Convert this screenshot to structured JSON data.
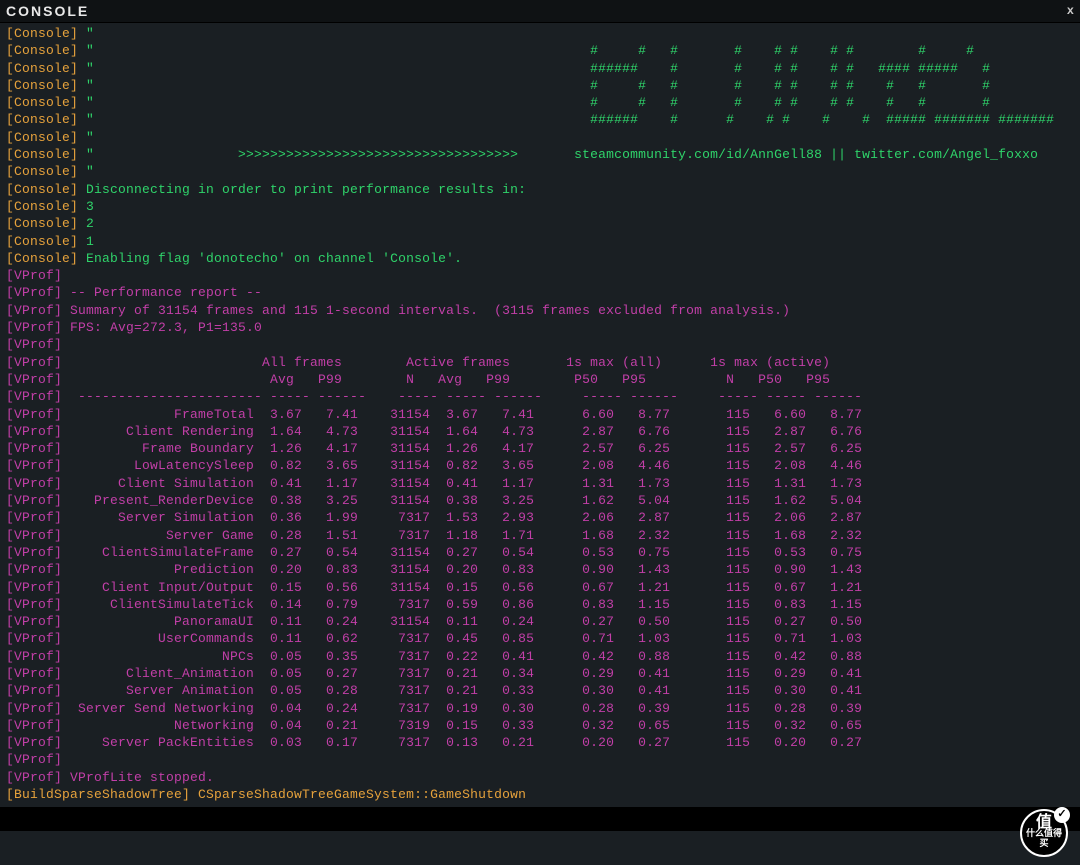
{
  "window": {
    "title": "CONSOLE",
    "close_label": "x"
  },
  "ascii": [
    "[Console] \"                                                              #     #   #       #    # #    # #        #     #",
    "[Console] \"                                                              ######    #       #    # #    # #   #### #####   #",
    "[Console] \"                                                              #     #   #       #    # #    # #    #   #       #",
    "[Console] \"                                                              #     #   #       #    # #    # #    #   #       #",
    "[Console] \"                                                              ######    #      #    # #    #    #  ##### ####### #######",
    "[Console] \"",
    "[Console] \"                  >>>>>>>>>>>>>>>>>>>>>>>>>>>>>>>>>>>       steamcommunity.com/id/AnnGell88 || twitter.com/Angel_foxxo      <<<<<<<<<<<<<<<<<<",
    "[Console] \""
  ],
  "disconnect_msg": "Disconnecting in order to print performance results in:",
  "countdown": [
    "3",
    "2",
    "1"
  ],
  "enable_flag_msg": "Enabling flag 'donotecho' on channel 'Console'.",
  "vprof_header": [
    "",
    "-- Performance report --",
    "Summary of 31154 frames and 115 1-second intervals.  (3115 frames excluded from analysis.)",
    "FPS: Avg=272.3, P1=135.0",
    ""
  ],
  "table_head1": "                        All frames        Active frames       1s max (all)      1s max (active)",
  "table_head2": "                         Avg   P99        N   Avg   P99        P50   P95          N   P50   P95",
  "table_dash": " ----------------------- ----- ------    ----- ----- ------     ----- ------     ----- ----- ------",
  "rows": [
    {
      "name": "FrameTotal",
      "avg": "3.67",
      "p99": "7.41",
      "an": "31154",
      "aavg": "3.67",
      "ap99": "7.41",
      "p50": "6.60",
      "p95": "8.77",
      "sn": "115",
      "sp50": "6.60",
      "sp95": "8.77"
    },
    {
      "name": "Client Rendering",
      "avg": "1.64",
      "p99": "4.73",
      "an": "31154",
      "aavg": "1.64",
      "ap99": "4.73",
      "p50": "2.87",
      "p95": "6.76",
      "sn": "115",
      "sp50": "2.87",
      "sp95": "6.76"
    },
    {
      "name": "Frame Boundary",
      "avg": "1.26",
      "p99": "4.17",
      "an": "31154",
      "aavg": "1.26",
      "ap99": "4.17",
      "p50": "2.57",
      "p95": "6.25",
      "sn": "115",
      "sp50": "2.57",
      "sp95": "6.25"
    },
    {
      "name": "LowLatencySleep",
      "avg": "0.82",
      "p99": "3.65",
      "an": "31154",
      "aavg": "0.82",
      "ap99": "3.65",
      "p50": "2.08",
      "p95": "4.46",
      "sn": "115",
      "sp50": "2.08",
      "sp95": "4.46"
    },
    {
      "name": "Client Simulation",
      "avg": "0.41",
      "p99": "1.17",
      "an": "31154",
      "aavg": "0.41",
      "ap99": "1.17",
      "p50": "1.31",
      "p95": "1.73",
      "sn": "115",
      "sp50": "1.31",
      "sp95": "1.73"
    },
    {
      "name": "Present_RenderDevice",
      "avg": "0.38",
      "p99": "3.25",
      "an": "31154",
      "aavg": "0.38",
      "ap99": "3.25",
      "p50": "1.62",
      "p95": "5.04",
      "sn": "115",
      "sp50": "1.62",
      "sp95": "5.04"
    },
    {
      "name": "Server Simulation",
      "avg": "0.36",
      "p99": "1.99",
      "an": "7317",
      "aavg": "1.53",
      "ap99": "2.93",
      "p50": "2.06",
      "p95": "2.87",
      "sn": "115",
      "sp50": "2.06",
      "sp95": "2.87"
    },
    {
      "name": "Server Game",
      "avg": "0.28",
      "p99": "1.51",
      "an": "7317",
      "aavg": "1.18",
      "ap99": "1.71",
      "p50": "1.68",
      "p95": "2.32",
      "sn": "115",
      "sp50": "1.68",
      "sp95": "2.32"
    },
    {
      "name": "ClientSimulateFrame",
      "avg": "0.27",
      "p99": "0.54",
      "an": "31154",
      "aavg": "0.27",
      "ap99": "0.54",
      "p50": "0.53",
      "p95": "0.75",
      "sn": "115",
      "sp50": "0.53",
      "sp95": "0.75"
    },
    {
      "name": "Prediction",
      "avg": "0.20",
      "p99": "0.83",
      "an": "31154",
      "aavg": "0.20",
      "ap99": "0.83",
      "p50": "0.90",
      "p95": "1.43",
      "sn": "115",
      "sp50": "0.90",
      "sp95": "1.43"
    },
    {
      "name": "Client Input/Output",
      "avg": "0.15",
      "p99": "0.56",
      "an": "31154",
      "aavg": "0.15",
      "ap99": "0.56",
      "p50": "0.67",
      "p95": "1.21",
      "sn": "115",
      "sp50": "0.67",
      "sp95": "1.21"
    },
    {
      "name": "ClientSimulateTick",
      "avg": "0.14",
      "p99": "0.79",
      "an": "7317",
      "aavg": "0.59",
      "ap99": "0.86",
      "p50": "0.83",
      "p95": "1.15",
      "sn": "115",
      "sp50": "0.83",
      "sp95": "1.15"
    },
    {
      "name": "PanoramaUI",
      "avg": "0.11",
      "p99": "0.24",
      "an": "31154",
      "aavg": "0.11",
      "ap99": "0.24",
      "p50": "0.27",
      "p95": "0.50",
      "sn": "115",
      "sp50": "0.27",
      "sp95": "0.50"
    },
    {
      "name": "UserCommands",
      "avg": "0.11",
      "p99": "0.62",
      "an": "7317",
      "aavg": "0.45",
      "ap99": "0.85",
      "p50": "0.71",
      "p95": "1.03",
      "sn": "115",
      "sp50": "0.71",
      "sp95": "1.03"
    },
    {
      "name": "NPCs",
      "avg": "0.05",
      "p99": "0.35",
      "an": "7317",
      "aavg": "0.22",
      "ap99": "0.41",
      "p50": "0.42",
      "p95": "0.88",
      "sn": "115",
      "sp50": "0.42",
      "sp95": "0.88"
    },
    {
      "name": "Client_Animation",
      "avg": "0.05",
      "p99": "0.27",
      "an": "7317",
      "aavg": "0.21",
      "ap99": "0.34",
      "p50": "0.29",
      "p95": "0.41",
      "sn": "115",
      "sp50": "0.29",
      "sp95": "0.41"
    },
    {
      "name": "Server Animation",
      "avg": "0.05",
      "p99": "0.28",
      "an": "7317",
      "aavg": "0.21",
      "ap99": "0.33",
      "p50": "0.30",
      "p95": "0.41",
      "sn": "115",
      "sp50": "0.30",
      "sp95": "0.41"
    },
    {
      "name": "Server Send Networking",
      "avg": "0.04",
      "p99": "0.24",
      "an": "7317",
      "aavg": "0.19",
      "ap99": "0.30",
      "p50": "0.28",
      "p95": "0.39",
      "sn": "115",
      "sp50": "0.28",
      "sp95": "0.39"
    },
    {
      "name": "Networking",
      "avg": "0.04",
      "p99": "0.21",
      "an": "7319",
      "aavg": "0.15",
      "ap99": "0.33",
      "p50": "0.32",
      "p95": "0.65",
      "sn": "115",
      "sp50": "0.32",
      "sp95": "0.65"
    },
    {
      "name": "Server PackEntities",
      "avg": "0.03",
      "p99": "0.17",
      "an": "7317",
      "aavg": "0.13",
      "ap99": "0.21",
      "p50": "0.20",
      "p95": "0.27",
      "sn": "115",
      "sp50": "0.20",
      "sp95": "0.27"
    }
  ],
  "vprof_footer": [
    "",
    "VProfLite stopped."
  ],
  "build_line": {
    "tag": "[BuildSparseShadowTree]",
    "msg": " CSparseShadowTreeGameSystem::GameShutdown"
  },
  "watermark": {
    "line1": "值",
    "line2": "什么值得买"
  }
}
